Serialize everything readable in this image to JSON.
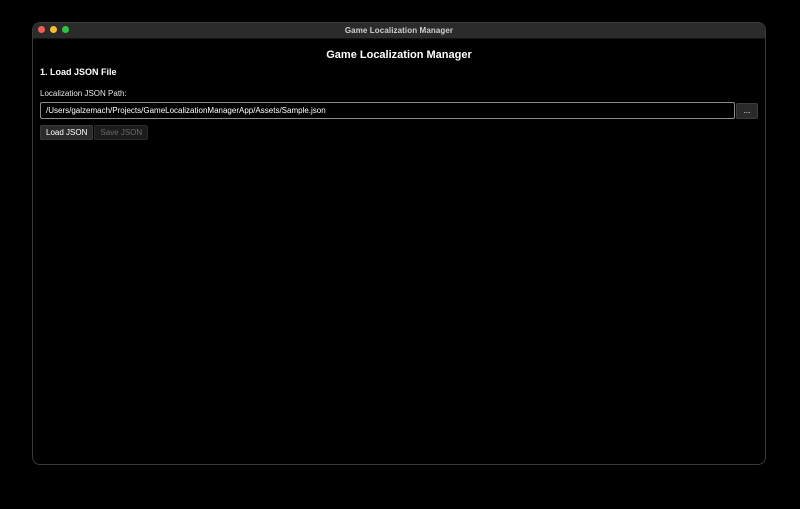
{
  "window": {
    "title": "Game Localization Manager"
  },
  "app": {
    "title": "Game Localization Manager"
  },
  "section": {
    "title": "1. Load JSON File"
  },
  "path_field": {
    "label": "Localization JSON Path:",
    "value": "/Users/galzemach/Projects/GameLocalizationManagerApp/Assets/Sample.json",
    "browse_label": "..."
  },
  "actions": {
    "load_label": "Load JSON",
    "save_label": "Save JSON"
  },
  "colors": {
    "background": "#000000",
    "titlebar": "#2b2b2b",
    "close": "#ee5f57",
    "minimize": "#f5bd2f",
    "maximize": "#2ac640"
  }
}
